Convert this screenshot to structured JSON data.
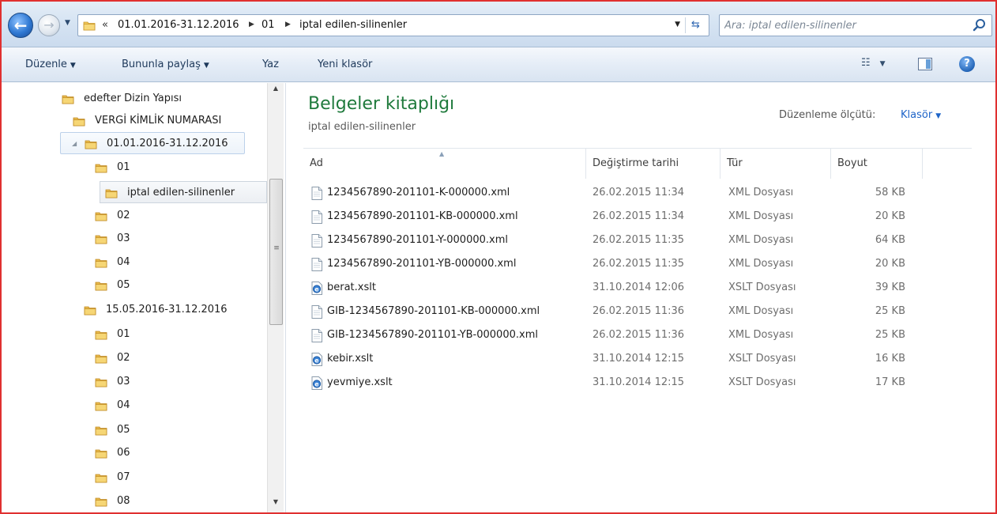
{
  "address_bar": {
    "breadcrumbs": [
      "01.01.2016-31.12.2016",
      "01",
      "iptal edilen-silinenler"
    ],
    "overflow_glyph": "«",
    "search_placeholder": "Ara: iptal edilen-silinenler"
  },
  "command_bar": {
    "organize_label": "Düzenle",
    "share_label": "Bununla paylaş",
    "burn_label": "Yaz",
    "new_folder_label": "Yeni klasör"
  },
  "navigation": {
    "items": [
      {
        "label": "edefter Dizin Yapısı"
      },
      {
        "label": "VERGİ KİMLİK NUMARASI"
      },
      {
        "label": "01.01.2016-31.12.2016"
      },
      {
        "label": "01"
      },
      {
        "label": "iptal edilen-silinenler"
      },
      {
        "label": "02"
      },
      {
        "label": "03"
      },
      {
        "label": "04"
      },
      {
        "label": "05"
      },
      {
        "label": "15.05.2016-31.12.2016"
      },
      {
        "label": "01"
      },
      {
        "label": "02"
      },
      {
        "label": "03"
      },
      {
        "label": "04"
      },
      {
        "label": "05"
      },
      {
        "label": "06"
      },
      {
        "label": "07"
      },
      {
        "label": "08"
      }
    ]
  },
  "library": {
    "title": "Belgeler kitaplığı",
    "subtitle": "iptal edilen-silinenler",
    "arrange_label": "Düzenleme ölçütü:",
    "arrange_value": "Klasör"
  },
  "columns": [
    "Ad",
    "Değiştirme tarihi",
    "Tür",
    "Boyut"
  ],
  "files": [
    {
      "name": "1234567890-201101-K-000000.xml",
      "date": "26.02.2015 11:34",
      "type": "XML Dosyası",
      "size": "58 KB",
      "icon": "xml-file-icon"
    },
    {
      "name": "1234567890-201101-KB-000000.xml",
      "date": "26.02.2015 11:34",
      "type": "XML Dosyası",
      "size": "20 KB",
      "icon": "xml-file-icon"
    },
    {
      "name": "1234567890-201101-Y-000000.xml",
      "date": "26.02.2015 11:35",
      "type": "XML Dosyası",
      "size": "64 KB",
      "icon": "xml-file-icon"
    },
    {
      "name": "1234567890-201101-YB-000000.xml",
      "date": "26.02.2015 11:35",
      "type": "XML Dosyası",
      "size": "20 KB",
      "icon": "xml-file-icon"
    },
    {
      "name": "berat.xslt",
      "date": "31.10.2014 12:06",
      "type": "XSLT Dosyası",
      "size": "39 KB",
      "icon": "xslt-file-icon"
    },
    {
      "name": "GIB-1234567890-201101-KB-000000.xml",
      "date": "26.02.2015 11:36",
      "type": "XML Dosyası",
      "size": "25 KB",
      "icon": "xml-file-icon"
    },
    {
      "name": "GIB-1234567890-201101-YB-000000.xml",
      "date": "26.02.2015 11:36",
      "type": "XML Dosyası",
      "size": "25 KB",
      "icon": "xml-file-icon"
    },
    {
      "name": "kebir.xslt",
      "date": "31.10.2014 12:15",
      "type": "XSLT Dosyası",
      "size": "16 KB",
      "icon": "xslt-file-icon"
    },
    {
      "name": "yevmiye.xslt",
      "date": "31.10.2014 12:15",
      "type": "XSLT Dosyası",
      "size": "17 KB",
      "icon": "xslt-file-icon"
    }
  ]
}
